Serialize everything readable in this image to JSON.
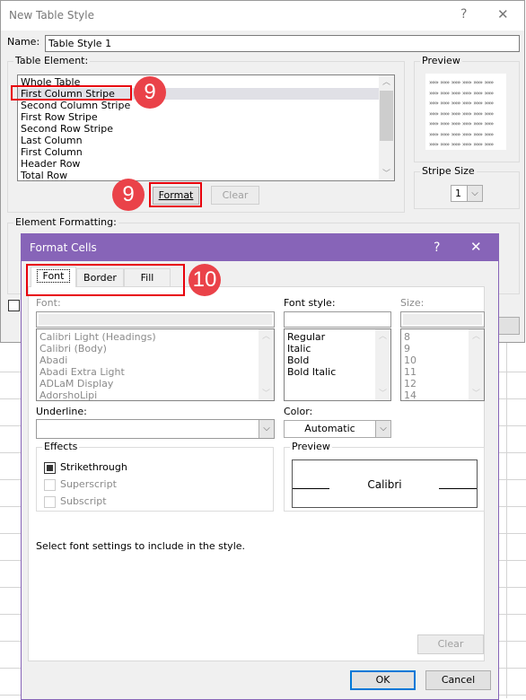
{
  "outer": {
    "title": "New Table Style",
    "help": "?",
    "close": "✕",
    "name_label": "Name:",
    "name_value": "Table Style 1",
    "table_element_label": "Table Element:",
    "elements": [
      "Whole Table",
      "First Column Stripe",
      "Second Column Stripe",
      "First Row Stripe",
      "Second Row Stripe",
      "Last Column",
      "First Column",
      "Header Row",
      "Total Row"
    ],
    "selected_index": 1,
    "format_label": "Format",
    "clear_label": "Clear",
    "preview_label": "Preview",
    "stripe_size_label": "Stripe Size",
    "stripe_size_value": "1",
    "element_formatting_label": "Element Formatting:"
  },
  "annotations": {
    "badge_a": "9",
    "badge_b": "9",
    "badge_c": "10",
    "color": "#ea4249"
  },
  "format_cells": {
    "title": "Format Cells",
    "help": "?",
    "close": "✕",
    "tabs": [
      "Font",
      "Border",
      "Fill"
    ],
    "active_tab": "Font",
    "font_label": "Font:",
    "font_value": "",
    "fonts": [
      "Calibri Light (Headings)",
      "Calibri (Body)",
      "Abadi",
      "Abadi Extra Light",
      "ADLaM Display",
      "AdorshoLipi"
    ],
    "style_label": "Font style:",
    "style_value": "",
    "styles": [
      "Regular",
      "Italic",
      "Bold",
      "Bold Italic"
    ],
    "size_label": "Size:",
    "size_value": "",
    "sizes": [
      "8",
      "9",
      "10",
      "11",
      "12",
      "14"
    ],
    "underline_label": "Underline:",
    "underline_value": "",
    "color_label": "Color:",
    "color_value": "Automatic",
    "effects_label": "Effects",
    "effects": [
      {
        "label": "Strikethrough",
        "state": "indeterminate",
        "enabled": true
      },
      {
        "label": "Superscript",
        "state": "unchecked",
        "enabled": false
      },
      {
        "label": "Subscript",
        "state": "unchecked",
        "enabled": false
      }
    ],
    "preview_label": "Preview",
    "preview_text": "Calibri",
    "hint": "Select font settings to include in the style.",
    "clear_label": "Clear",
    "ok_label": "OK",
    "cancel_label": "Cancel",
    "accent": "#8764b8"
  }
}
